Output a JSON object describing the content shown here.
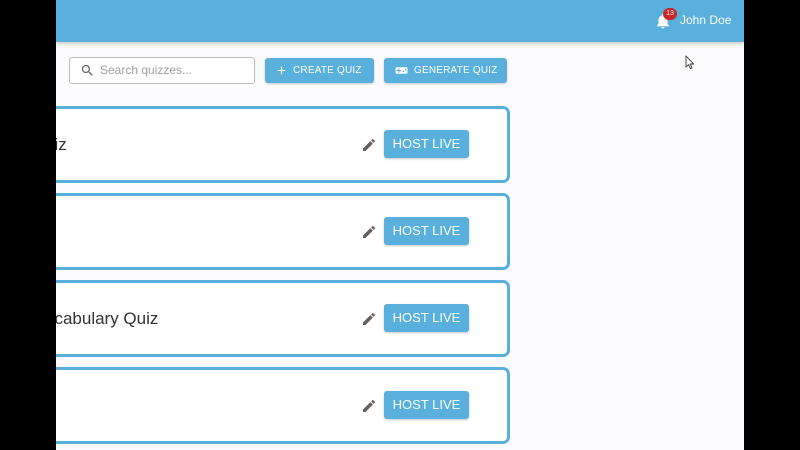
{
  "header": {
    "notification_count": "13",
    "user_name": "John Doe"
  },
  "toolbar": {
    "search_placeholder": "Search quizzes...",
    "search_value": "",
    "create_label": "CREATE QUIZ",
    "generate_label": "GENERATE QUIZ"
  },
  "quizzes": [
    {
      "title": "uiz",
      "host_label": "HOST LIVE"
    },
    {
      "title": "",
      "host_label": "HOST LIVE"
    },
    {
      "title": "ocabulary Quiz",
      "host_label": "HOST LIVE"
    },
    {
      "title": "",
      "host_label": "HOST LIVE"
    }
  ],
  "icons": {
    "notifications": "bell-icon",
    "search": "search-icon",
    "create": "plus-icon",
    "generate": "gamepad-icon",
    "edit": "pencil-icon",
    "cursor": "mouse-pointer-icon"
  },
  "colors": {
    "primary": "#5ab0dc",
    "badge": "#c62828",
    "background": "#fbfbfd",
    "text": "#333333"
  }
}
